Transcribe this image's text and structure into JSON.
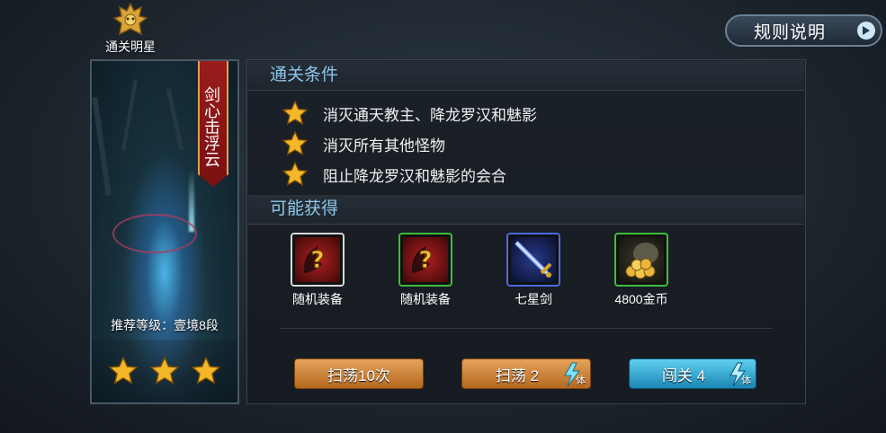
{
  "badge": {
    "label": "通关明星",
    "icon": "gold-helmet-icon"
  },
  "rules_button": {
    "label": "规则说明",
    "icon": "play-arrow-icon"
  },
  "stage": {
    "banner_title": "剑心击浮云",
    "recommended_level": "推荐等级：壹境8段",
    "stars": 3
  },
  "conditions": {
    "title": "通关条件",
    "items": [
      "消灭通天教主、降龙罗汉和魅影",
      "消灭所有其他怪物",
      "阻止降龙罗汉和魅影的会合"
    ]
  },
  "rewards": {
    "title": "可能获得",
    "items": [
      {
        "label": "随机装备",
        "icon": "random-equipment-icon",
        "border": "#d8d8d8"
      },
      {
        "label": "随机装备",
        "icon": "random-equipment-icon",
        "border": "#3dbd3d"
      },
      {
        "label": "七星剑",
        "icon": "seven-star-sword-icon",
        "border": "#4a6be0"
      },
      {
        "label": "4800金币",
        "icon": "gold-coins-icon",
        "border": "#3dbd3d"
      }
    ]
  },
  "actions": {
    "sweep10": {
      "label": "扫荡10次"
    },
    "sweep": {
      "label": "扫荡 2",
      "energy_label": "体"
    },
    "challenge": {
      "label": "闯关 4",
      "energy_label": "体"
    }
  },
  "colors": {
    "accent_blue": "#8ec6ea",
    "orange_button": "#d08a3e",
    "blue_button": "#2aa5d2",
    "banner_red": "#8d1717"
  }
}
